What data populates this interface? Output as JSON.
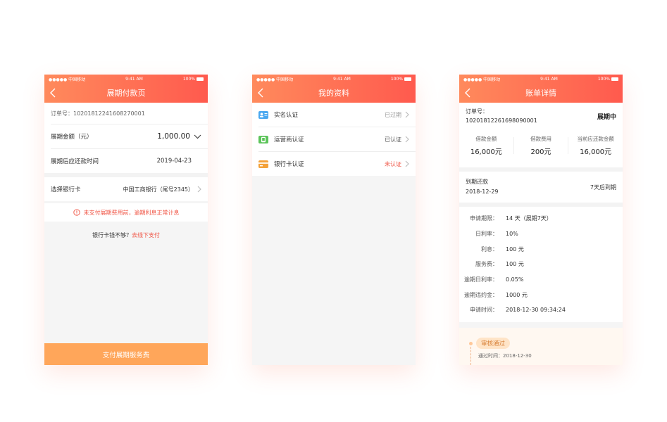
{
  "status_bar": {
    "carrier": "●●●●● 中国移动",
    "time": "9:41 AM",
    "battery": "100%"
  },
  "screen1": {
    "title": "展期付款页",
    "order_label": "订单号：",
    "order_no": "10201812241608270001",
    "amount_label": "展期金额（元）",
    "amount_value": "1,000.00",
    "due_label": "展期后应还款时间",
    "due_value": "2019-04-23",
    "bank_label": "选择银行卡",
    "bank_value": "中国工商银行（尾号2345）",
    "warning": "未支付展期费用前，逾期利息正常计息",
    "offline_text": "银行卡钱不够？",
    "offline_link": "去线下支付",
    "pay_button": "支付展期服务费"
  },
  "screen2": {
    "title": "我的资料",
    "items": [
      {
        "label": "实名认证",
        "status": "已过期",
        "icon": "id-card-icon",
        "color": "#4aa8f0",
        "status_color": "#999999"
      },
      {
        "label": "运营商认证",
        "status": "已认证",
        "icon": "phone-operator-icon",
        "color": "#5cc45a",
        "status_color": "#555555"
      },
      {
        "label": "银行卡认证",
        "status": "未认证",
        "icon": "bank-card-icon",
        "color": "#f4a23a",
        "status_color": "#f05545"
      }
    ]
  },
  "screen3": {
    "title": "账单详情",
    "order_label": "订单号：",
    "order_no": "10201812261698090001",
    "order_status": "展期中",
    "stats": [
      {
        "label": "借款金额",
        "value": "16,000元"
      },
      {
        "label": "借款费用",
        "value": "200元"
      },
      {
        "label": "当前应还款金额",
        "value": "16,000元"
      }
    ],
    "due_label": "到期还款",
    "due_date": "2018-12-29",
    "due_note": "7天后到期",
    "details": [
      {
        "k": "申请期限：",
        "v": "14 天（展期7天）"
      },
      {
        "k": "日利率：",
        "v": "10%"
      },
      {
        "k": "利息：",
        "v": "100 元"
      },
      {
        "k": "服务费：",
        "v": "100 元"
      },
      {
        "k": "逾期日利率：",
        "v": "0.05%"
      },
      {
        "k": "逾期违约金：",
        "v": "1000 元"
      },
      {
        "k": "申请时间：",
        "v": "2018-12-30   09:34:24"
      }
    ],
    "audit_badge": "审核通过",
    "audit_time_label": "通过时间：",
    "audit_time": "2018-12-30"
  }
}
